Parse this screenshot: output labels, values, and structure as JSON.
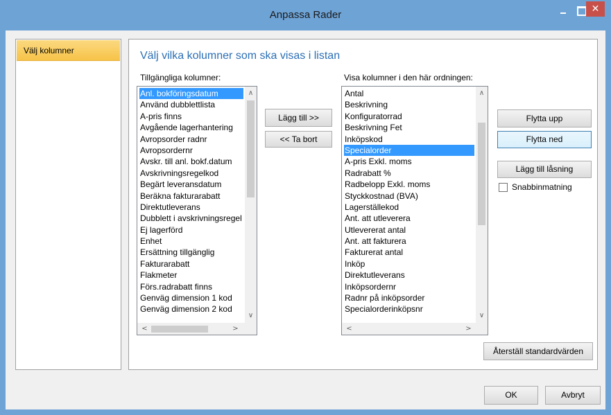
{
  "window": {
    "title": "Anpassa Rader",
    "close_glyph": "✕"
  },
  "nav": {
    "items": [
      {
        "label": "Välj kolumner"
      }
    ]
  },
  "main": {
    "heading": "Välj vilka kolumner som ska visas i listan",
    "available_label": "Tillgängliga kolumner:",
    "visible_label": "Visa kolumner i den här ordningen:",
    "available_columns": [
      "Anl. bokföringsdatum",
      "Använd dubblettlista",
      "A-pris finns",
      "Avgående lagerhantering",
      "Avropsorder radnr",
      "Avropsordernr",
      "Avskr. till anl. bokf.datum",
      "Avskrivningsregelkod",
      "Begärt leveransdatum",
      "Beräkna fakturarabatt",
      "Direktutleverans",
      "Dubblett i avskrivningsregel",
      "Ej lagerförd",
      "Enhet",
      "Ersättning tillgänglig",
      "Fakturarabatt",
      "Flakmeter",
      "Förs.radrabatt finns",
      "Genväg dimension 1 kod",
      "Genväg dimension 2 kod"
    ],
    "available_selected_index": 0,
    "visible_columns": [
      "Antal",
      "Beskrivning",
      "Konfiguratorrad",
      "Beskrivning Fet",
      "Inköpskod",
      "Specialorder",
      "A-pris Exkl. moms",
      "Radrabatt %",
      "Radbelopp Exkl. moms",
      "Styckkostnad (BVA)",
      "Lagerställekod",
      "Ant. att utleverera",
      "Utlevererat antal",
      "Ant. att fakturera",
      "Fakturerat antal",
      "Inköp",
      "Direktutleverans",
      "Inköpsordernr",
      "Radnr på inköpsorder",
      "Specialorderinköpsnr"
    ],
    "visible_selected_index": 5,
    "add_button": "Lägg till >>",
    "remove_button": "<< Ta bort",
    "move_up_button": "Flytta upp",
    "move_down_button": "Flytta ned",
    "add_lock_button": "Lägg till låsning",
    "quick_entry_label": "Snabbinmatning",
    "quick_entry_checked": false,
    "reset_button": "Återställ standardvärden"
  },
  "footer": {
    "ok_button": "OK",
    "cancel_button": "Avbryt"
  },
  "scroll_glyphs": {
    "up": "∧",
    "down": "∨",
    "left": "<",
    "right": ">"
  },
  "colors": {
    "titlebar": "#6ea3d6",
    "selection": "#3399ff",
    "heading": "#2c6fb5",
    "nav_selected": "#f7c348",
    "close_button": "#c7504a"
  }
}
